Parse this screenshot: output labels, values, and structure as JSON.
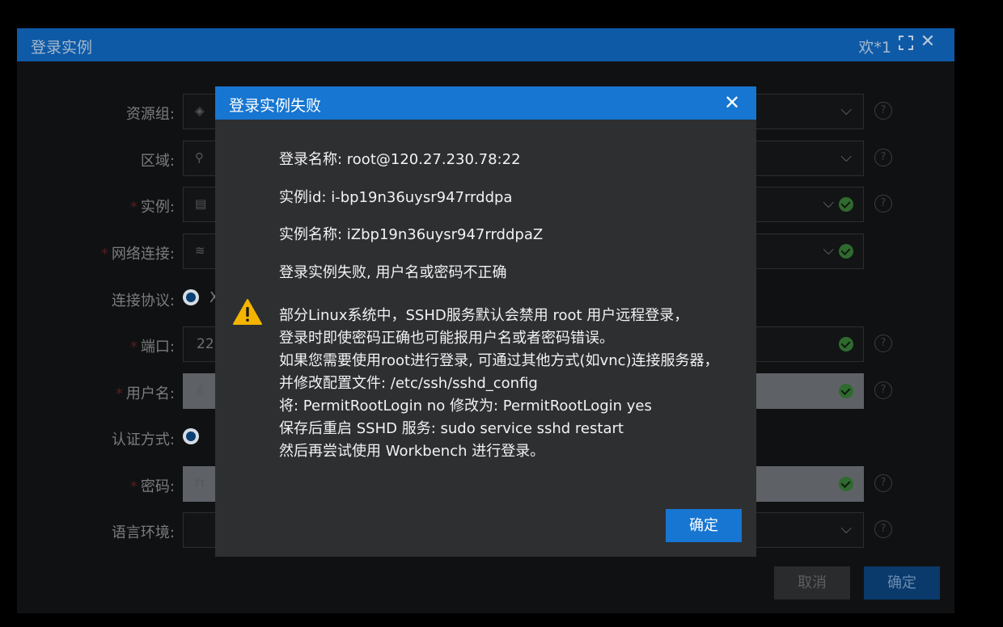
{
  "window": {
    "title": "登录实例",
    "user": "欢*1",
    "close_glyph": "✕"
  },
  "form": {
    "rows": [
      {
        "label": "资源组:",
        "required": false
      },
      {
        "label": "区域:",
        "required": false
      },
      {
        "label": "实例:",
        "required": true
      },
      {
        "label": "网络连接:",
        "required": true
      },
      {
        "label": "连接协议:",
        "required": false
      },
      {
        "label": "端口:",
        "required": true,
        "value": "22"
      },
      {
        "label": "用户名:",
        "required": true
      },
      {
        "label": "认证方式:",
        "required": false
      },
      {
        "label": "密码:",
        "required": true
      },
      {
        "label": "语言环境:",
        "required": false
      }
    ],
    "required_mark": "*",
    "protocol_partial": "X",
    "cancel_label": "取消",
    "confirm_label": "确定"
  },
  "dialog": {
    "title": "登录实例失败",
    "close_glyph": "✕",
    "login_name": "登录名称: root@120.27.230.78:22",
    "instance_id": "实例id: i-bp19n36uysr947rrddpa",
    "instance_name": "实例名称: iZbp19n36uysr947rrddpaZ",
    "error": "登录实例失败, 用户名或密码不正确",
    "warning_lines": [
      "部分Linux系统中，SSHD服务默认会禁用 root 用户远程登录，",
      "登录时即使密码正确也可能报用户名或者密码错误。",
      "如果您需要使用root进行登录, 可通过其他方式(如vnc)连接服务器，",
      "并修改配置文件: /etc/ssh/sshd_config",
      "将: PermitRootLogin no 修改为: PermitRootLogin yes",
      "保存后重启 SSHD 服务: sudo service sshd restart",
      "然后再尝试使用 Workbench 进行登录。"
    ],
    "ok_label": "确定"
  },
  "colors": {
    "header_blue": "#1776d1",
    "warning_yellow": "#f5b400",
    "success_green": "#2f6a2e"
  }
}
